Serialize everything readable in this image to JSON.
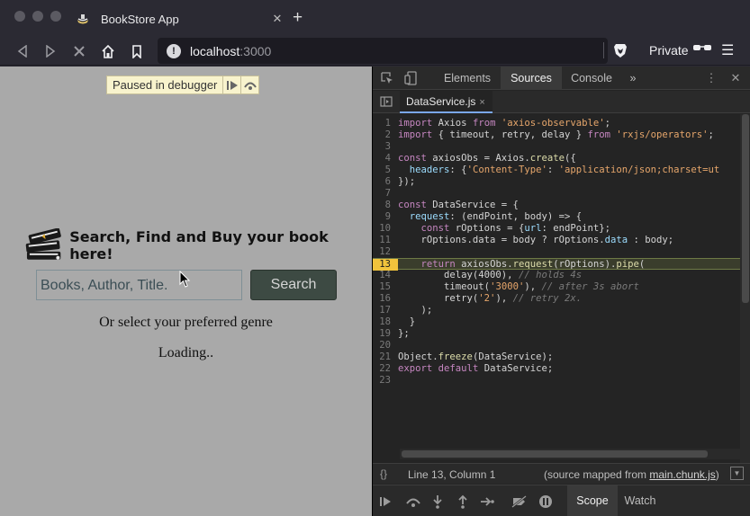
{
  "tab": {
    "title": "BookStore App",
    "close": "✕",
    "new_tab": "+"
  },
  "toolbar": {
    "url_host": "localhost",
    "url_port": ":3000",
    "private_label": "Private"
  },
  "page": {
    "debugger_banner": "Paused in debugger",
    "heading": "Search, Find and Buy your book here!",
    "search_placeholder": "Books, Author, Title.",
    "search_button": "Search",
    "genre_text": "Or select your preferred genre",
    "loading_text": "Loading.."
  },
  "devtools": {
    "tabs": [
      "Elements",
      "Sources",
      "Console"
    ],
    "active_tab": "Sources",
    "more_tabs": "»",
    "file_tab": "DataService.js",
    "status_position": "Line 13, Column 1",
    "source_map_prefix": "(source mapped from ",
    "source_map_file": "main.chunk.js",
    "source_map_suffix": ")",
    "debug_tabs": [
      "Scope",
      "Watch"
    ],
    "active_debug_tab": "Scope",
    "highlighted_line": 13,
    "code_lines": [
      "import Axios from 'axios-observable';",
      "import { timeout, retry, delay } from 'rxjs/operators';",
      "",
      "const axiosObs = Axios.create({",
      "  headers: {'Content-Type': 'application/json;charset=ut",
      "});",
      "",
      "const DataService = {",
      "  request: (endPoint, body) => {",
      "    const rOptions = {url: endPoint};",
      "    rOptions.data = body ? rOptions.data : body;",
      "",
      "    return axiosObs.request(rOptions).pipe(",
      "        delay(4000), // holds 4s",
      "        timeout('3000'), // after 3s abort",
      "        retry('2'), // retry 2x.",
      "    );",
      "  }",
      "};",
      "",
      "Object.freeze(DataService);",
      "export default DataService;",
      ""
    ]
  },
  "colors": {
    "page_bg": "#a9a9a9",
    "search_button_bg": "#3d4a43",
    "devtools_bg": "#242424",
    "breakpoint_line": "#f1c33c"
  }
}
